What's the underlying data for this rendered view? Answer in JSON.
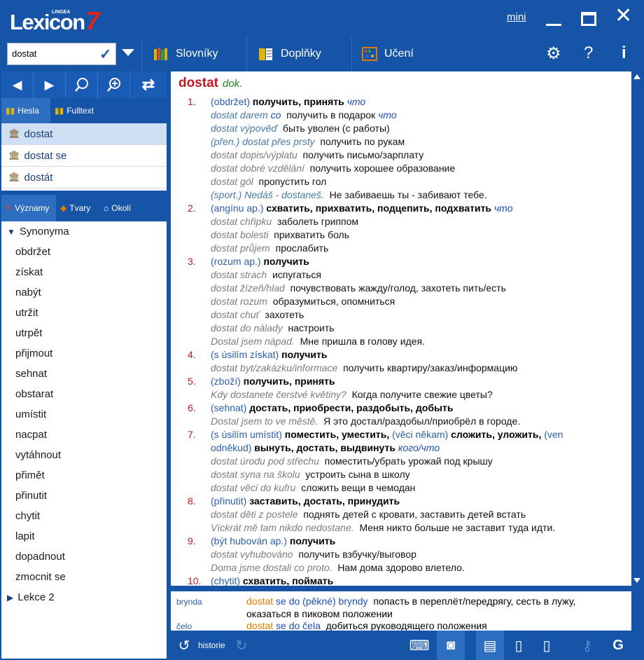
{
  "app": {
    "logo_small": "LINGEA",
    "logo_text": "Lexicon",
    "logo_num": "7",
    "mini": "mini"
  },
  "toolbar": {
    "search_value": "dostat",
    "slovniky": "Slovníky",
    "doplnky": "Doplňky",
    "uceni": "Učení"
  },
  "tabs1": {
    "hesla": "Hesla",
    "fulltext": "Fulltext"
  },
  "headwords": [
    "dostat",
    "dostat se",
    "dostát"
  ],
  "tabs2": {
    "vyznamy": "Významy",
    "tvary": "Tvary",
    "okoli": "Okolí"
  },
  "synonyms": {
    "group": "Synonyma",
    "items": [
      "obdržet",
      "získat",
      "nabýt",
      "utržit",
      "utrpět",
      "přijmout",
      "sehnat",
      "obstarat",
      "umístit",
      "nacpat",
      "vytáhnout",
      "přimět",
      "přinutit",
      "chytit",
      "lapit",
      "dopadnout",
      "zmocnit se"
    ],
    "group2": "Lekce 2"
  },
  "entry": {
    "headword": "dostat",
    "pos": "dok.",
    "lines": [
      {
        "num": "1.",
        "sp": "(obdržet)",
        "ru": "получить, принять",
        "it": "что"
      },
      {
        "ex": "dostat darem",
        "exit": "co",
        "tr": "получить в подарок",
        "trit": "что",
        "exstyle": "b"
      },
      {
        "ex": "dostat výpověď",
        "tr": "быть уволен (с работы)",
        "exstyle": "b"
      },
      {
        "ex": "(přen.) dostat přes prsty",
        "tr": "получить по рукам",
        "exstyle": "b"
      },
      {
        "ex": "dostat dopis/výplatu",
        "tr": "получить письмо/зарплату"
      },
      {
        "ex": "dostat dobré vzdělání",
        "tr": "получить хорошее образование"
      },
      {
        "ex": "dostat gól",
        "tr": "пропустить гол"
      },
      {
        "ex": "(sport.) Nedáš - dostaneš.",
        "tr": "Не забиваешь ты - забивают тебе.",
        "exstyle": "s"
      },
      {
        "num": "2.",
        "sp": "(angínu ap.)",
        "ru": "схватить, прихватить, подцепить, подхватить",
        "it": "что"
      },
      {
        "ex": "dostat chřipku",
        "tr": "заболеть гриппом"
      },
      {
        "ex": "dostat bolesti",
        "tr": "прихватить боль"
      },
      {
        "ex": "dostat průjem",
        "tr": "прослабить"
      },
      {
        "num": "3.",
        "sp": "(rozum ap.)",
        "ru": "получить"
      },
      {
        "ex": "dostat strach",
        "tr": "испугаться"
      },
      {
        "ex": "dostat žízeň/hlad",
        "tr": "почувствовать жажду/голод, захотеть пить/есть"
      },
      {
        "ex": "dostat rozum",
        "tr": "образумиться, опомниться"
      },
      {
        "ex": "dostat chuť",
        "tr": "захотеть"
      },
      {
        "ex": "dostat do nálady",
        "tr": "настроить"
      },
      {
        "ex": "Dostal jsem nápad.",
        "tr": "Мне пришла в голову идея."
      },
      {
        "num": "4.",
        "sp": "(s úsilím získat)",
        "ru": "получить"
      },
      {
        "ex": "dostat byt/zakázku/informace",
        "tr": "получить квартиру/заказ/информацию"
      },
      {
        "num": "5.",
        "sp": "(zboží)",
        "ru": "получить, принять"
      },
      {
        "ex": "Kdy dostanete čerstvé květiny?",
        "tr": "Когда получите свежие цветы?"
      },
      {
        "num": "6.",
        "sp": "(sehnat)",
        "ru": "достать, приобрести, раздобыть, добыть"
      },
      {
        "ex": "Dostal jsem to ve městě.",
        "tr": "Я это достал/раздобыл/приобрёл в городе."
      },
      {
        "num": "7.",
        "sp": "(s úsilím umístit)",
        "ru": "поместить, уместить,",
        "sp2": "(věci někam)",
        "ru2": "сложить, уложить,",
        "sp3": "(ven"
      },
      {
        "sp": "odněkud)",
        "ru": "вынуть, достать, выдвинуть",
        "it": "кого/что",
        "cont": true
      },
      {
        "ex": "dostat úrodu pod střechu",
        "tr": "поместить/убрать урожай под крышу"
      },
      {
        "ex": "dostat syna na školu",
        "tr": "устроить сына в школу"
      },
      {
        "ex": "dostat věci do kufru",
        "tr": "сложить вещи в чемодан"
      },
      {
        "num": "8.",
        "sp": "(přinutit)",
        "ru": "заставить, достать, принудить"
      },
      {
        "ex": "dostat děti z postele",
        "tr": "поднять детей с кровати, заставить детей встать"
      },
      {
        "ex": "Víckrát mě tam nikdo nedostane.",
        "tr": "Меня никто больше не заставит туда идти."
      },
      {
        "num": "9.",
        "sp": "(být hubován ap.)",
        "ru": "получить"
      },
      {
        "ex": "dostat vyhubováno",
        "tr": "получить взбучку/выговор"
      },
      {
        "ex": "Doma jsme dostali co proto.",
        "tr": "Нам дома здорово влетело."
      },
      {
        "num": "10.",
        "sp": "(chytit)",
        "ru": "схватить, поймать"
      }
    ]
  },
  "bottom": [
    {
      "key": "brynda",
      "p1": "dostat",
      "p2": "se do (pěkné) bryndy",
      "tr": "попасть в переплёт/передрягу, сесть в лужу,",
      "tr2": "оказаться в пиковом положении"
    },
    {
      "key": "čelo",
      "p1": "dostat",
      "p2": "se do čela",
      "tr": "добиться руководящего положения"
    }
  ],
  "status": {
    "historie": "historie"
  }
}
